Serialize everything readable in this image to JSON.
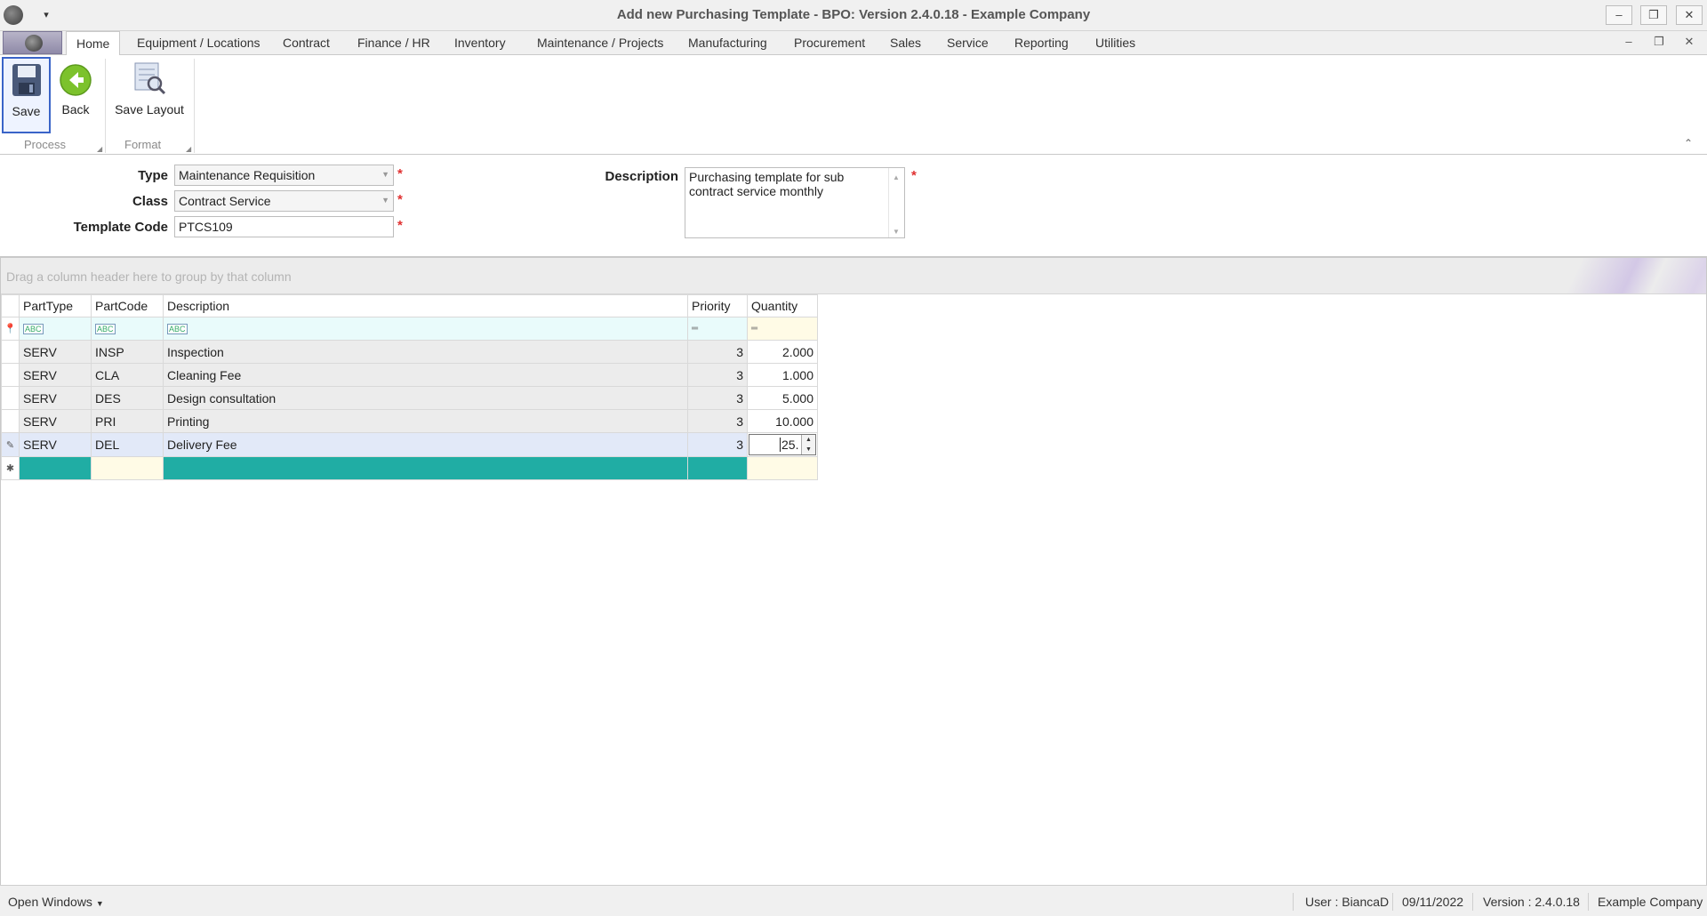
{
  "window": {
    "title": "Add new Purchasing Template - BPO: Version 2.4.0.18 - Example Company",
    "minimize_label": "–",
    "maximize_label": "❐",
    "close_label": "✕",
    "qa_dropdown_label": "▾"
  },
  "ribbon": {
    "tabs": [
      {
        "label": "Home"
      },
      {
        "label": "Equipment / Locations"
      },
      {
        "label": "Contract"
      },
      {
        "label": "Finance / HR"
      },
      {
        "label": "Inventory"
      },
      {
        "label": "Maintenance / Projects"
      },
      {
        "label": "Manufacturing"
      },
      {
        "label": "Procurement"
      },
      {
        "label": "Sales"
      },
      {
        "label": "Service"
      },
      {
        "label": "Reporting"
      },
      {
        "label": "Utilities"
      }
    ],
    "active_tab": "Home",
    "buttons": {
      "save": "Save",
      "back": "Back",
      "save_layout": "Save Layout"
    },
    "groups": {
      "process": "Process",
      "format": "Format"
    }
  },
  "form": {
    "type_label": "Type",
    "type_value": "Maintenance Requisition",
    "class_label": "Class",
    "class_value": "Contract Service",
    "template_code_label": "Template Code",
    "template_code_value": "PTCS109",
    "description_label": "Description",
    "description_value": "Purchasing template for sub contract service monthly",
    "required_marker": "*"
  },
  "grid": {
    "group_panel_hint": "Drag a column header here to group by that column",
    "columns": [
      "PartType",
      "PartCode",
      "Description",
      "Priority",
      "Quantity"
    ],
    "rows": [
      {
        "part_type": "SERV",
        "part_code": "INSP",
        "description": "Inspection",
        "priority": "3",
        "quantity": "2.000"
      },
      {
        "part_type": "SERV",
        "part_code": "CLA",
        "description": "Cleaning Fee",
        "priority": "3",
        "quantity": "1.000"
      },
      {
        "part_type": "SERV",
        "part_code": "DES",
        "description": "Design consultation",
        "priority": "3",
        "quantity": "5.000"
      },
      {
        "part_type": "SERV",
        "part_code": "PRI",
        "description": "Printing",
        "priority": "3",
        "quantity": "10.000"
      },
      {
        "part_type": "SERV",
        "part_code": "DEL",
        "description": "Delivery Fee",
        "priority": "3",
        "quantity": "25."
      }
    ],
    "editing_row_index": 4
  },
  "statusbar": {
    "open_windows": "Open Windows",
    "user": "User : BiancaD",
    "date": "09/11/2022",
    "version": "Version : 2.4.0.18",
    "company": "Example Company"
  },
  "colors": {
    "accent_blue": "#3a64c8",
    "required_red": "#e03030",
    "new_row_teal": "#20ada4",
    "filter_cyan": "#e9fbfb",
    "editing_row": "#e2e9f8"
  }
}
